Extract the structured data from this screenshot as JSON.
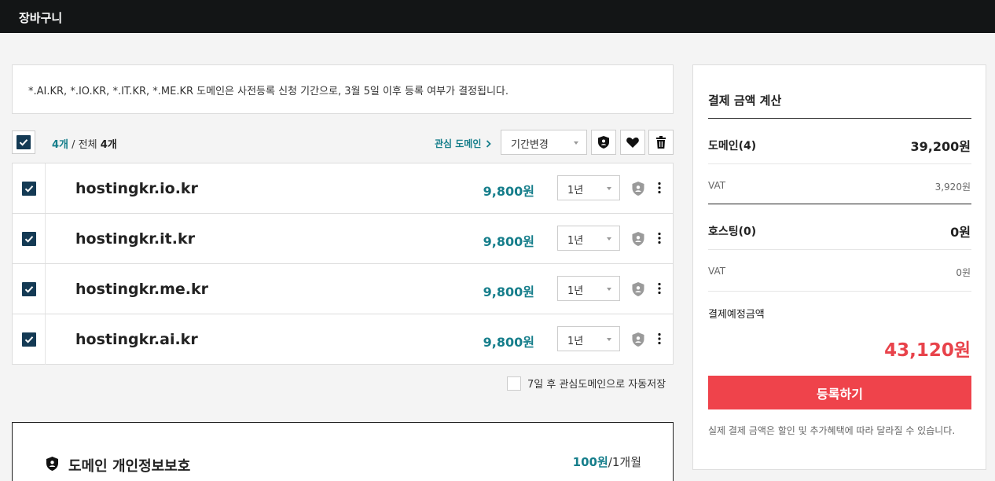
{
  "header": {
    "title": "장바구니"
  },
  "notice": {
    "text": "*.AI.KR, *.IO.KR, *.IT.KR, *.ME.KR 도메인은 사전등록 신청 기간으로, 3월 5일 이후 등록 여부가 결정됩니다."
  },
  "toolbar": {
    "selected_count": "4개",
    "separator": " / 전체 ",
    "total_count": "4개",
    "watch_link": "관심 도메인",
    "period_select": "기간변경",
    "icons": [
      "privacy-shield-icon",
      "heart-icon",
      "trash-icon"
    ]
  },
  "cart": {
    "items": [
      {
        "domain": "hostingkr.io.kr",
        "price": "9,800원",
        "term": "1년",
        "checked": true
      },
      {
        "domain": "hostingkr.it.kr",
        "price": "9,800원",
        "term": "1년",
        "checked": true
      },
      {
        "domain": "hostingkr.me.kr",
        "price": "9,800원",
        "term": "1년",
        "checked": true
      },
      {
        "domain": "hostingkr.ai.kr",
        "price": "9,800원",
        "term": "1년",
        "checked": true
      }
    ]
  },
  "autosave": {
    "label": "7일 후 관심도메인으로 자동저장",
    "checked": false
  },
  "privacy": {
    "title": "도메인 개인정보보호",
    "price": "100원",
    "unit": "/1개월"
  },
  "summary": {
    "title": "결제 금액 계산",
    "domain_label": "도메인(4)",
    "domain_value": "39,200원",
    "domain_vat_label": "VAT",
    "domain_vat_value": "3,920원",
    "hosting_label": "호스팅(0)",
    "hosting_value": "0원",
    "hosting_vat_label": "VAT",
    "hosting_vat_value": "0원",
    "due_label": "결제예정금액",
    "due_value": "43,120원",
    "register_button": "등록하기",
    "note": "실제 결제 금액은 할인 및 추가혜택에 따라 달라질 수 있습니다."
  },
  "colors": {
    "topbar": "#131516",
    "accent_teal": "#167e8b",
    "checkbox": "#143a54",
    "cta_red": "#ef434b",
    "total_red": "#e8434b"
  }
}
